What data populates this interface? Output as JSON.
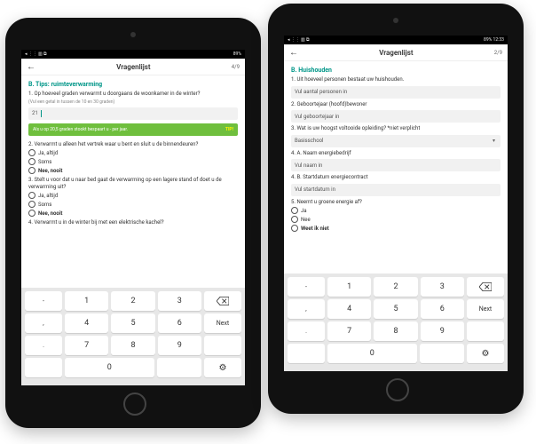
{
  "status": {
    "left": "◂ ⋮⋮ ▥ ⧉",
    "batt_left": "89%",
    "batt_right": "89% 12:33"
  },
  "appbar": {
    "title": "Vragenlijst"
  },
  "left": {
    "progress": "4/9",
    "section": "B. Tips: ruimteverwarming",
    "q1": "1. Op hoeveel graden verwarmt u doorgaans de woonkamer in de winter?",
    "hint1": "(Vul een getal in tussen de 10 en 30 graden)",
    "v1": "21",
    "tip": "Als u op 20,5 graden stookt bespaart u - per jaar.",
    "tip_tag": "TIP!",
    "q2": "2. Verwarmt u alleen het vertrek waar u bent en sluit u de binnendeuren?",
    "q3": "3. Stelt u voor dat u naar bed gaat de verwarming op een lagere stand of doet u de verwarming uit?",
    "q4": "4. Verwarmt u in de winter bij met een elektrische kachel?",
    "opts": {
      "a": "Ja, altijd",
      "b": "Soms",
      "c": "Nee, nooit"
    }
  },
  "right": {
    "progress": "2/9",
    "section": "B. Huishouden",
    "q1": "1. Uit hoeveel personen bestaat uw huishouden.",
    "ph1": "Vul aantal personen in",
    "q2": "2. Geboortejaar (hoofd)bewoner",
    "ph2": "Vul geboortejaar in",
    "q3": "3. Wat is uw hoogst voltooide opleiding? *niet verplicht",
    "v3": "Basisschool",
    "q4a": "4. A. Naam energiebedrijf",
    "ph4a": "Vul naam in",
    "q4b": "4. B. Startdatum energiecontract",
    "ph4b": "Vul startdatum in",
    "q5": "5. Neemt u groene energie af?",
    "opts": {
      "a": "Ja",
      "b": "Nee",
      "c": "Weet ik niet"
    }
  },
  "keys": {
    "k1": "1",
    "k2": "2",
    "k3": "3",
    "k4": "4",
    "k5": "5",
    "k6": "6",
    "k7": "7",
    "k8": "8",
    "k9": "9",
    "k0": "0",
    "dash": "-",
    "dot": ".",
    "comma": ",",
    "next": "Next",
    "gear": "⚙"
  }
}
